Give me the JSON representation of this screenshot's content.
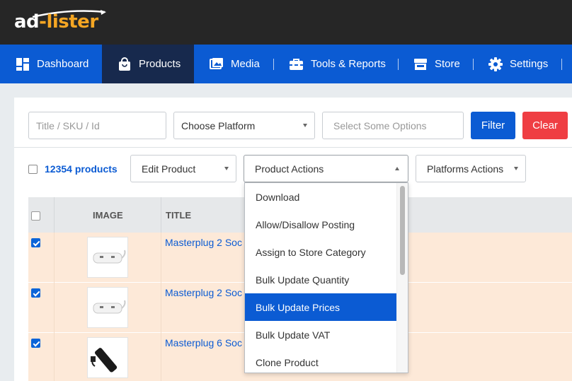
{
  "app": {
    "logo_ad": "ad",
    "logo_dash": "-",
    "logo_lister": "lister"
  },
  "nav": {
    "items": [
      {
        "label": "Dashboard",
        "icon": "dashboard-icon"
      },
      {
        "label": "Products",
        "icon": "shopping-bag-icon",
        "active": true
      },
      {
        "label": "Media",
        "icon": "image-icon"
      },
      {
        "label": "Tools & Reports",
        "icon": "toolbox-icon"
      },
      {
        "label": "Store",
        "icon": "store-icon"
      },
      {
        "label": "Settings",
        "icon": "gear-icon"
      }
    ]
  },
  "filters": {
    "search_placeholder": "Title / SKU / Id",
    "platform_select": "Choose Platform",
    "options_placeholder": "Select Some Options",
    "filter_label": "Filter",
    "clear_label": "Clear"
  },
  "toolbar": {
    "count": "12354 products",
    "edit_product": "Edit Product",
    "product_actions": "Product Actions",
    "platforms_actions": "Platforms Actions"
  },
  "table": {
    "headers": {
      "image": "IMAGE",
      "title": "TITLE"
    },
    "rows": [
      {
        "title": "Masterplug 2 Soc",
        "checked": true
      },
      {
        "title": "Masterplug 2 Soc",
        "checked": true
      },
      {
        "title": "Masterplug 6 Soc",
        "checked": true
      }
    ]
  },
  "product_actions_menu": {
    "items": [
      "Download",
      "Allow/Disallow Posting",
      "Assign to Store Category",
      "Bulk Update Quantity",
      "Bulk Update Prices",
      "Bulk Update VAT",
      "Clone Product"
    ],
    "highlighted": "Bulk Update Prices"
  },
  "colors": {
    "nav_bg": "#0b5bd3",
    "nav_active": "#17294d",
    "topbar": "#262626",
    "logo_orange": "#f5a623",
    "clear_red": "#ef3e43",
    "row_selected": "#fde9d8"
  }
}
